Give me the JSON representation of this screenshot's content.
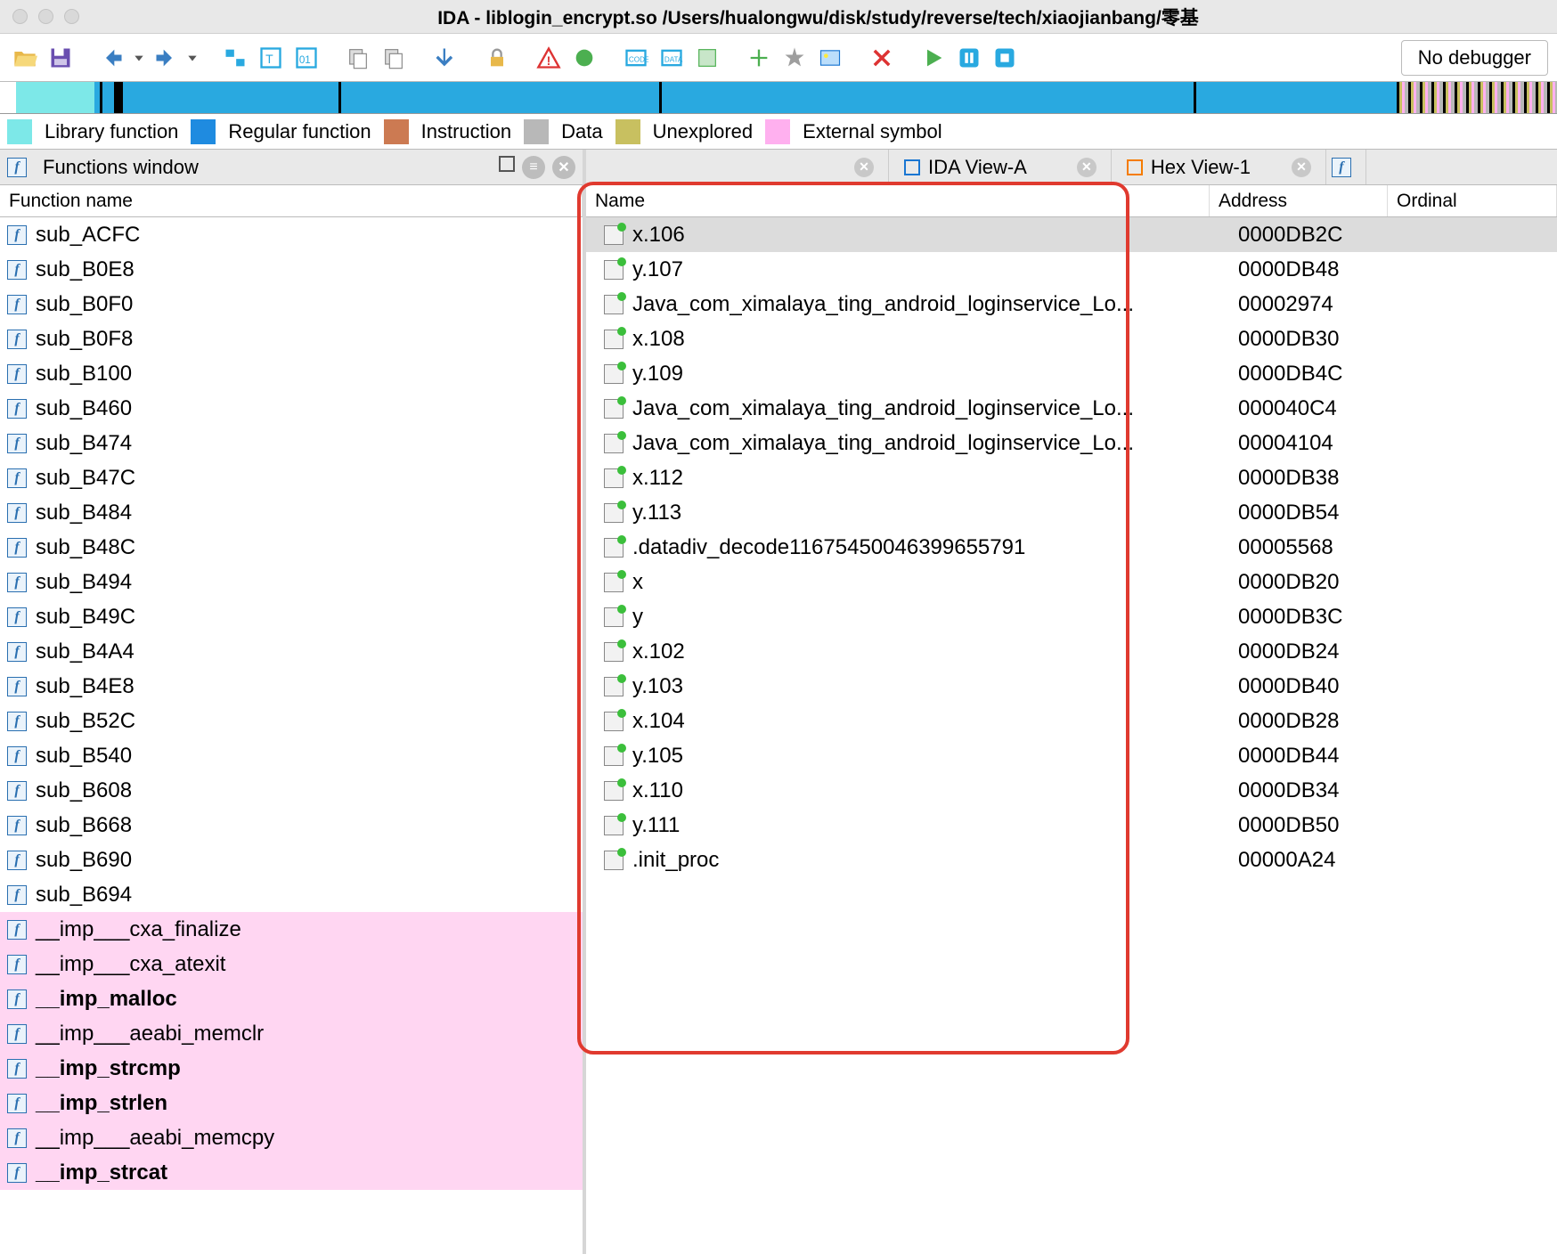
{
  "window": {
    "title": "IDA - liblogin_encrypt.so /Users/hualongwu/disk/study/reverse/tech/xiaojianbang/零基"
  },
  "debugger": {
    "label": "No debugger"
  },
  "legend": {
    "lib": "Library function",
    "reg": "Regular function",
    "ins": "Instruction",
    "data": "Data",
    "unex": "Unexplored",
    "ext": "External symbol"
  },
  "left": {
    "title": "Functions window",
    "column": "Function name",
    "rows": [
      {
        "name": "sub_ACFC",
        "ext": false
      },
      {
        "name": "sub_B0E8",
        "ext": false
      },
      {
        "name": "sub_B0F0",
        "ext": false
      },
      {
        "name": "sub_B0F8",
        "ext": false
      },
      {
        "name": "sub_B100",
        "ext": false
      },
      {
        "name": "sub_B460",
        "ext": false
      },
      {
        "name": "sub_B474",
        "ext": false
      },
      {
        "name": "sub_B47C",
        "ext": false
      },
      {
        "name": "sub_B484",
        "ext": false
      },
      {
        "name": "sub_B48C",
        "ext": false
      },
      {
        "name": "sub_B494",
        "ext": false
      },
      {
        "name": "sub_B49C",
        "ext": false
      },
      {
        "name": "sub_B4A4",
        "ext": false
      },
      {
        "name": "sub_B4E8",
        "ext": false
      },
      {
        "name": "sub_B52C",
        "ext": false
      },
      {
        "name": "sub_B540",
        "ext": false
      },
      {
        "name": "sub_B608",
        "ext": false
      },
      {
        "name": "sub_B668",
        "ext": false
      },
      {
        "name": "sub_B690",
        "ext": false
      },
      {
        "name": "sub_B694",
        "ext": false
      },
      {
        "name": "__imp___cxa_finalize",
        "ext": true
      },
      {
        "name": "__imp___cxa_atexit",
        "ext": true
      },
      {
        "name": "__imp_malloc",
        "ext": true,
        "bold": true
      },
      {
        "name": "__imp___aeabi_memclr",
        "ext": true
      },
      {
        "name": "__imp_strcmp",
        "ext": true,
        "bold": true
      },
      {
        "name": "__imp_strlen",
        "ext": true,
        "bold": true
      },
      {
        "name": "__imp___aeabi_memcpy",
        "ext": true
      },
      {
        "name": "__imp_strcat",
        "ext": true,
        "bold": true
      }
    ]
  },
  "right": {
    "tabs": {
      "view_a": "IDA View-A",
      "hex": "Hex View-1"
    },
    "columns": {
      "name": "Name",
      "address": "Address",
      "ordinal": "Ordinal"
    },
    "rows": [
      {
        "name": "x.106",
        "address": "0000DB2C",
        "sel": true
      },
      {
        "name": "y.107",
        "address": "0000DB48"
      },
      {
        "name": "Java_com_ximalaya_ting_android_loginservice_Lo...",
        "address": "00002974"
      },
      {
        "name": "x.108",
        "address": "0000DB30"
      },
      {
        "name": "y.109",
        "address": "0000DB4C"
      },
      {
        "name": "Java_com_ximalaya_ting_android_loginservice_Lo...",
        "address": "000040C4"
      },
      {
        "name": "Java_com_ximalaya_ting_android_loginservice_Lo...",
        "address": "00004104"
      },
      {
        "name": "x.112",
        "address": "0000DB38"
      },
      {
        "name": "y.113",
        "address": "0000DB54"
      },
      {
        "name": ".datadiv_decode11675450046399655791",
        "address": "00005568"
      },
      {
        "name": "x",
        "address": "0000DB20"
      },
      {
        "name": "y",
        "address": "0000DB3C"
      },
      {
        "name": "x.102",
        "address": "0000DB24"
      },
      {
        "name": "y.103",
        "address": "0000DB40"
      },
      {
        "name": "x.104",
        "address": "0000DB28"
      },
      {
        "name": "y.105",
        "address": "0000DB44"
      },
      {
        "name": "x.110",
        "address": "0000DB34"
      },
      {
        "name": "y.111",
        "address": "0000DB50"
      },
      {
        "name": ".init_proc",
        "address": "00000A24"
      }
    ]
  }
}
